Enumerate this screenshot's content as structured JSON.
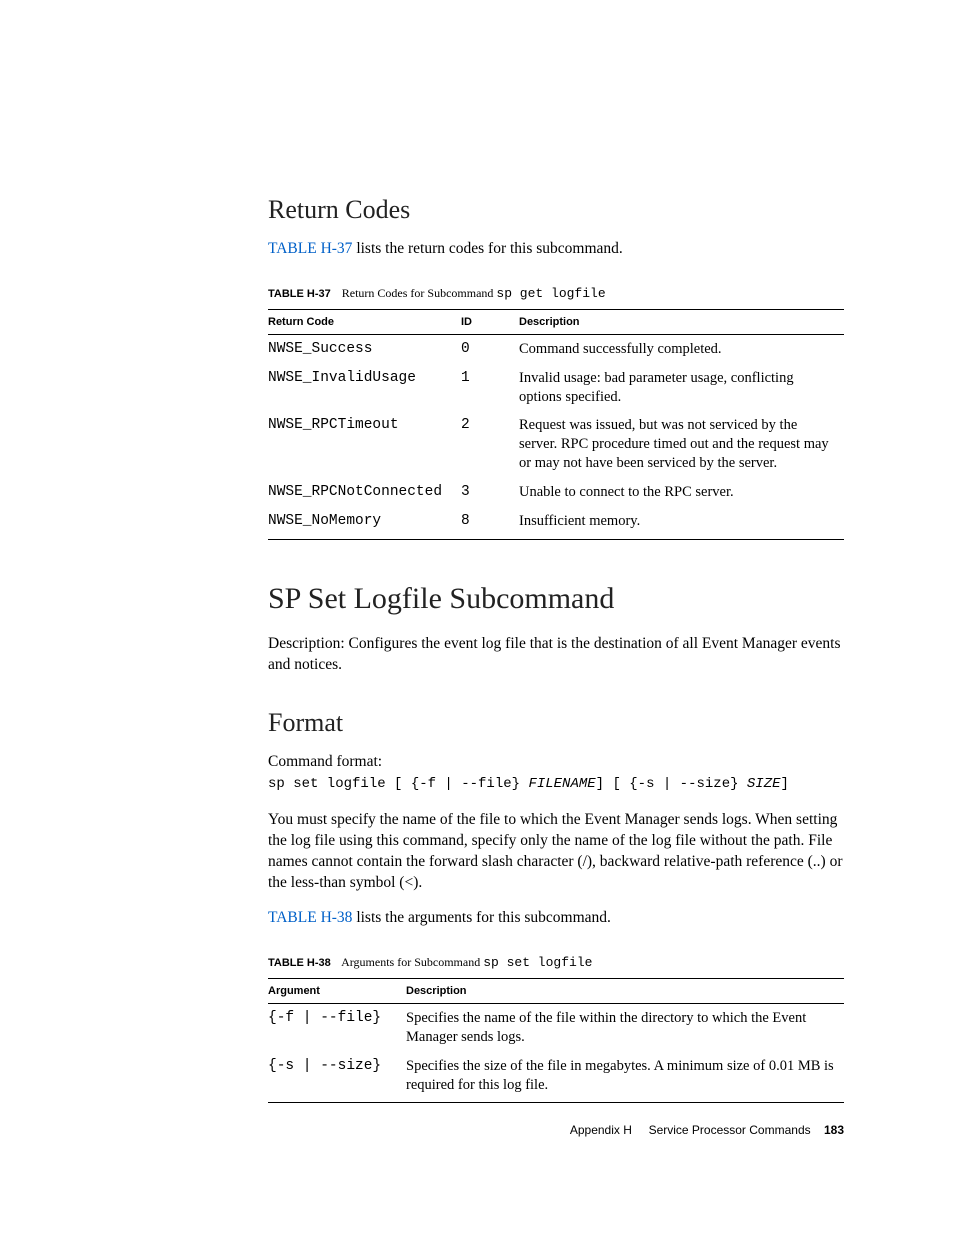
{
  "section1": {
    "heading": "Return Codes",
    "intro_pre": "TABLE H-37",
    "intro_post": " lists the return codes for this subcommand.",
    "table_caption_label": "TABLE H-37",
    "table_caption_text": "Return Codes for Subcommand ",
    "table_caption_code": "sp get logfile",
    "headers": {
      "c1": "Return Code",
      "c2": "ID",
      "c3": "Description"
    },
    "rows": [
      {
        "code": "NWSE_Success",
        "id": "0",
        "desc": "Command successfully completed."
      },
      {
        "code": "NWSE_InvalidUsage",
        "id": "1",
        "desc": "Invalid usage: bad parameter usage, conflicting options specified."
      },
      {
        "code": "NWSE_RPCTimeout",
        "id": "2",
        "desc": "Request was issued, but was not serviced by the server. RPC procedure timed out and the request may or may not have been serviced by the server."
      },
      {
        "code": "NWSE_RPCNotConnected",
        "id": "3",
        "desc": "Unable to connect to the RPC server."
      },
      {
        "code": "NWSE_NoMemory",
        "id": "8",
        "desc": "Insufficient memory."
      }
    ]
  },
  "section2": {
    "heading": "SP Set Logfile Subcommand",
    "desc": "Description: Configures the event log file that is the destination of all Event Manager events and notices.",
    "format_heading": "Format",
    "cmd_label": "Command format:",
    "cmd_p1": "sp set logfile [ {-f | --file} ",
    "cmd_i1": "FILENAME",
    "cmd_p2": "] [ {-s | --size} ",
    "cmd_i2": "SIZE",
    "cmd_p3": "]",
    "para": "You must specify the name of the file to which the Event Manager sends logs. When setting the log file using this command, specify only the name of the log file without the path. File names cannot contain the forward slash character (/), backward relative-path reference (..) or the less-than symbol (<).",
    "intro2_pre": "TABLE H-38",
    "intro2_post": " lists the arguments for this subcommand.",
    "table38_caption_label": "TABLE H-38",
    "table38_caption_text": "Arguments for Subcommand ",
    "table38_caption_code": "sp set logfile",
    "headers38": {
      "c1": "Argument",
      "c2": "Description"
    },
    "rows38": [
      {
        "arg": "{-f | --file}",
        "desc": "Specifies the name of the file within the directory to which the Event Manager sends logs."
      },
      {
        "arg": "{-s | --size}",
        "desc": "Specifies the size of the file in megabytes. A minimum size of 0.01 MB is required for this log file."
      }
    ]
  },
  "footer": {
    "appendix": "Appendix H",
    "title": "Service Processor Commands",
    "page": "183"
  }
}
